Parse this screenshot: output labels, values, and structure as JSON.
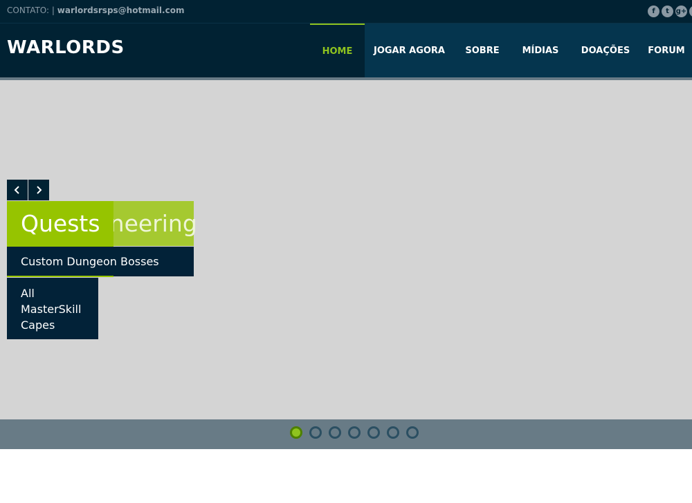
{
  "topbar": {
    "contact_label": "CONTATO: |",
    "email": "warlordsrsps@hotmail.com",
    "socials": [
      {
        "icon": "facebook-icon",
        "glyph": "f"
      },
      {
        "icon": "twitter-icon",
        "glyph": "t"
      },
      {
        "icon": "google-plus-icon",
        "glyph": "g+"
      },
      {
        "icon": "social-icon-partial",
        "glyph": ""
      }
    ]
  },
  "header": {
    "logo": "WARLORDS",
    "nav": [
      {
        "label": "HOME",
        "active": true
      },
      {
        "label": "JOGAR AGORA",
        "active": false
      },
      {
        "label": "SOBRE",
        "active": false
      },
      {
        "label": "MÍDIAS",
        "active": false
      },
      {
        "label": "DOAÇÕES",
        "active": false
      },
      {
        "label": "FORUM",
        "active": false
      }
    ]
  },
  "slider": {
    "back_caption": {
      "title": "Dungeoneering",
      "subtitle": "Custom Dungeon Bosses"
    },
    "front_caption": {
      "title": "Quests",
      "subtitle": "All MasterSkill Capes"
    },
    "slide_count": 7,
    "active_slide": 1
  },
  "colors": {
    "dark_navy": "#012233",
    "nav_blue": "#05354e",
    "accent_green": "#8fc31f",
    "hero_gray": "#d4d4d4",
    "bullet_bar": "#687b86"
  }
}
